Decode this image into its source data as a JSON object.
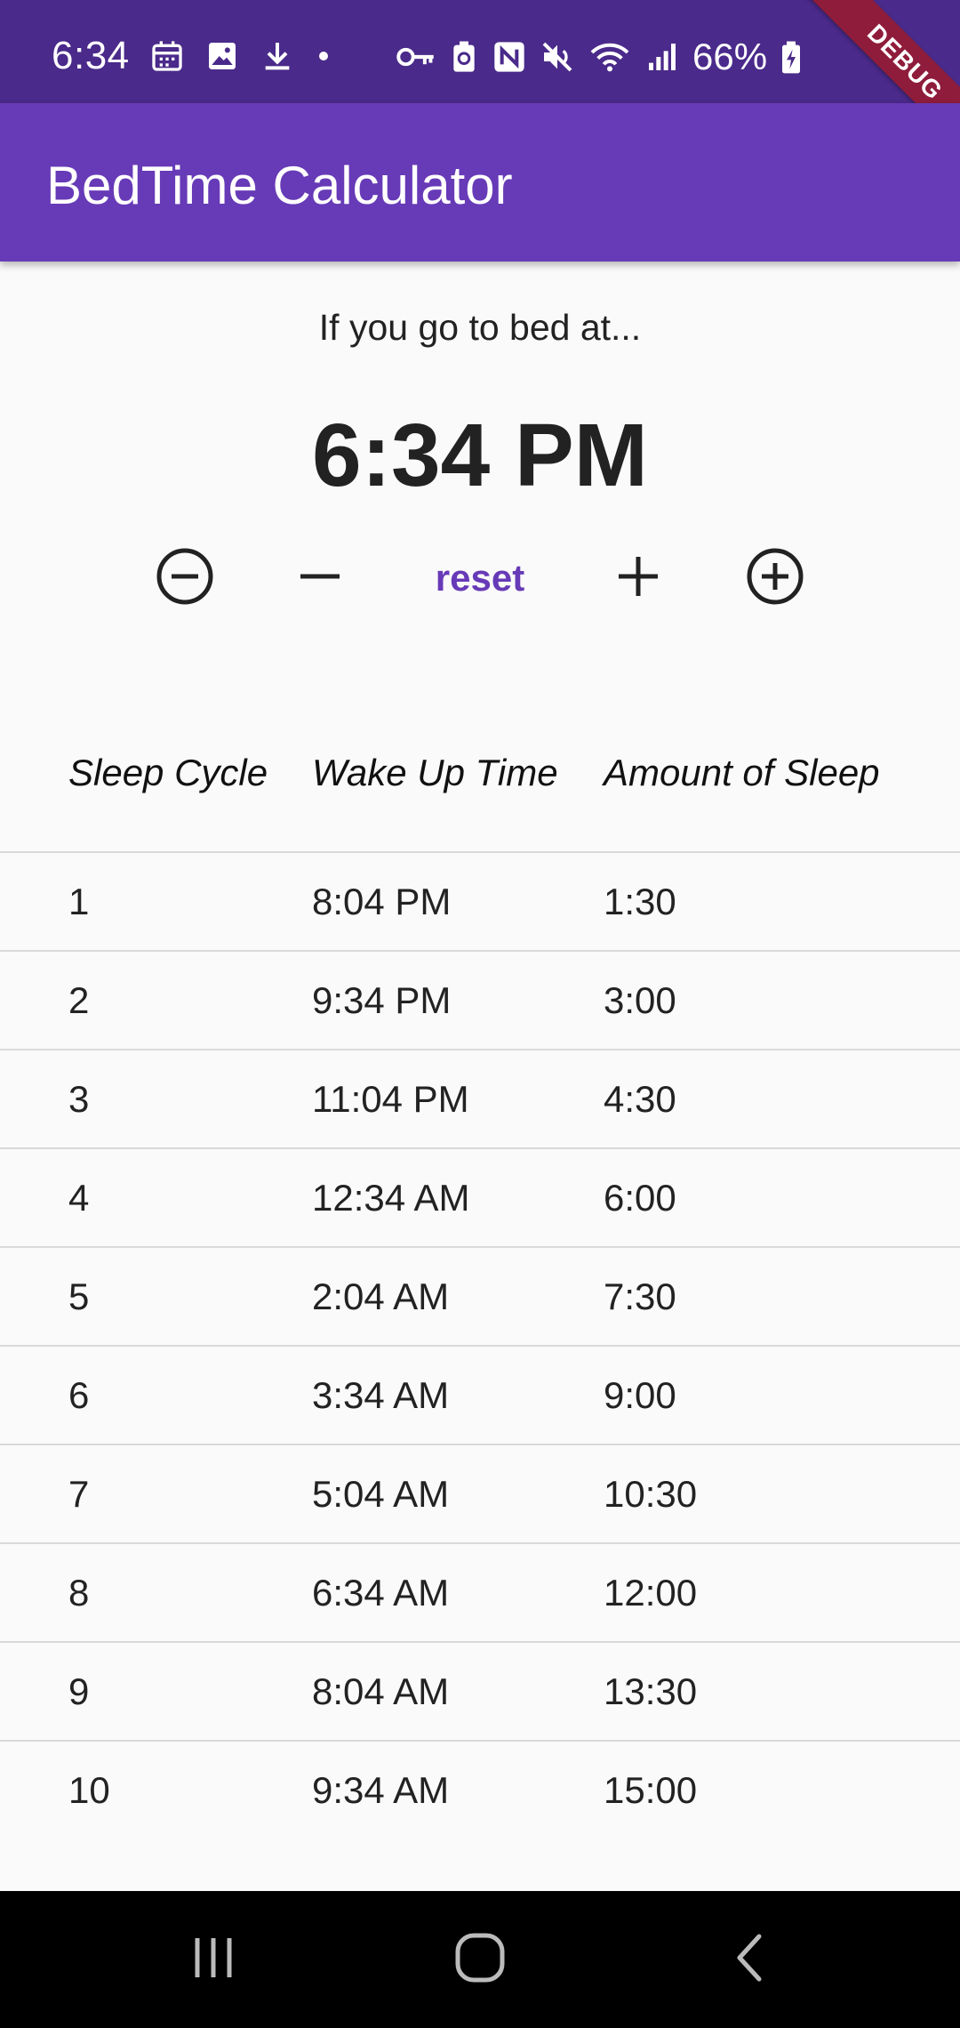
{
  "status_bar": {
    "time": "6:34",
    "battery_percent": "66%",
    "left_icons": [
      "calendar-icon",
      "image-icon",
      "download-icon",
      "dot-icon"
    ],
    "right_icons": [
      "key-icon",
      "battery-saver-icon",
      "nfc-icon",
      "mute-icon",
      "wifi-icon",
      "signal-icon",
      "battery-charging-icon"
    ]
  },
  "debug_banner": "DEBUG",
  "app_bar": {
    "title": "BedTime Calculator"
  },
  "main": {
    "prompt": "If you go to bed at...",
    "bedtime": "6:34 PM",
    "controls": {
      "reset_label": "reset",
      "icons": [
        "minus-circle-icon",
        "minus-icon",
        "plus-icon",
        "plus-circle-icon"
      ]
    }
  },
  "table": {
    "headers": [
      "Sleep Cycle",
      "Wake Up Time",
      "Amount of Sleep"
    ],
    "rows": [
      [
        "1",
        "8:04 PM",
        "1:30"
      ],
      [
        "2",
        "9:34 PM",
        "3:00"
      ],
      [
        "3",
        "11:04 PM",
        "4:30"
      ],
      [
        "4",
        "12:34 AM",
        "6:00"
      ],
      [
        "5",
        "2:04 AM",
        "7:30"
      ],
      [
        "6",
        "3:34 AM",
        "9:00"
      ],
      [
        "7",
        "5:04 AM",
        "10:30"
      ],
      [
        "8",
        "6:34 AM",
        "12:00"
      ],
      [
        "9",
        "8:04 AM",
        "13:30"
      ],
      [
        "10",
        "9:34 AM",
        "15:00"
      ]
    ]
  },
  "nav_bar": {
    "icons": [
      "recents-icon",
      "home-icon",
      "back-icon"
    ]
  },
  "colors": {
    "status_bar_bg": "#4a2a8a",
    "app_bar_bg": "#673ab7",
    "accent": "#673ab7",
    "debug_ribbon": "#8e1c3a",
    "nav_bar_bg": "#000000"
  }
}
